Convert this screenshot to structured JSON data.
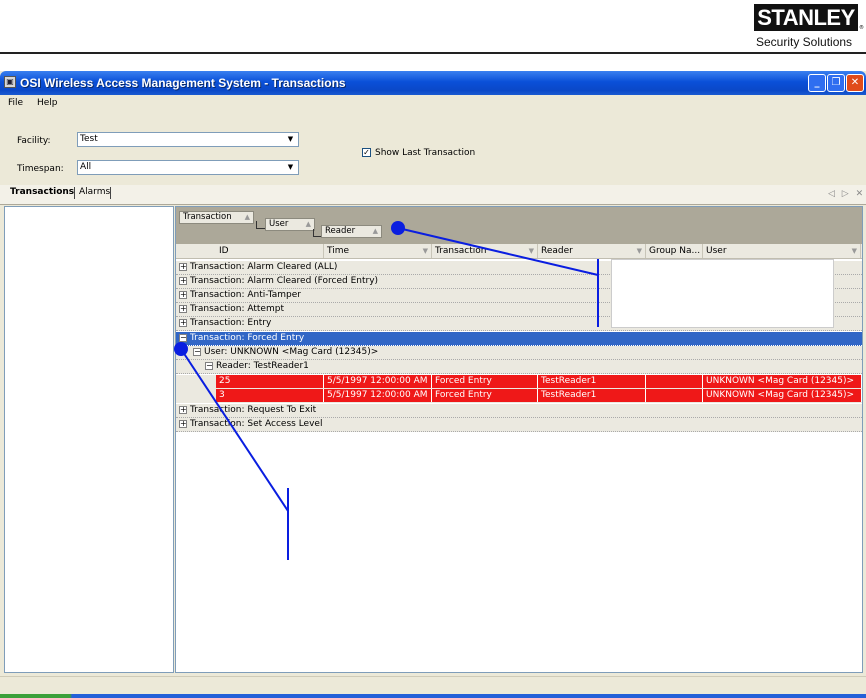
{
  "header": {
    "logo_text": "STANLEY",
    "logo_reg": "®",
    "tagline": "Security Solutions"
  },
  "window": {
    "title": "OSI Wireless Access Management System - Transactions",
    "app_icon_glyph": "▣",
    "caption_buttons": {
      "minimize": "_",
      "maximize": "❐",
      "close": "✕"
    }
  },
  "menu": {
    "file": "File",
    "help": "Help"
  },
  "filters": {
    "facility_label": "Facility:",
    "facility_value": "Test",
    "timespan_label": "Timespan:",
    "timespan_value": "All",
    "dropdown_glyph": "▼",
    "show_last_label": "Show Last Transaction",
    "show_last_checked": true,
    "check_glyph": "✓"
  },
  "tabs": {
    "transactions": "Transactions",
    "alarms": "Alarms",
    "nav_glyph": "◁ ▷ ✕"
  },
  "group_chips": {
    "transaction": "Transaction",
    "user": "User",
    "reader": "Reader",
    "sort_glyph": "▲"
  },
  "columns": {
    "id": "ID",
    "time": "Time",
    "transaction": "Transaction",
    "reader": "Reader",
    "group_name": "Group Na...",
    "user": "User",
    "sort_glyph": "▼"
  },
  "rows": {
    "r1": "Transaction:  Alarm Cleared (ALL)",
    "r2": "Transaction:  Alarm Cleared (Forced Entry)",
    "r3": "Transaction:  Anti-Tamper",
    "r4": "Transaction:  Attempt",
    "r5": "Transaction:  Entry",
    "r6": "Transaction:  Forced Entry",
    "r7": "User:  UNKNOWN <Mag Card (12345)>",
    "r8": "Reader:  TestReader1",
    "r11": "Transaction:  Request To Exit",
    "r12": "Transaction:  Set Access Level",
    "plus": "+",
    "minus": "−"
  },
  "records": [
    {
      "id": "25",
      "time": "5/5/1997 12:00:00 AM",
      "transaction": "Forced Entry",
      "reader": "TestReader1",
      "group": "",
      "user": "UNKNOWN <Mag Card (12345)>"
    },
    {
      "id": "3",
      "time": "5/5/1997 12:00:00 AM",
      "transaction": "Forced Entry",
      "reader": "TestReader1",
      "group": "",
      "user": "UNKNOWN <Mag Card (12345)>"
    }
  ],
  "colors": {
    "selection": "#3166c6",
    "alarm_row": "#ef1818",
    "callout": "#0a1ee0",
    "titlebar": "#0a50d8"
  }
}
